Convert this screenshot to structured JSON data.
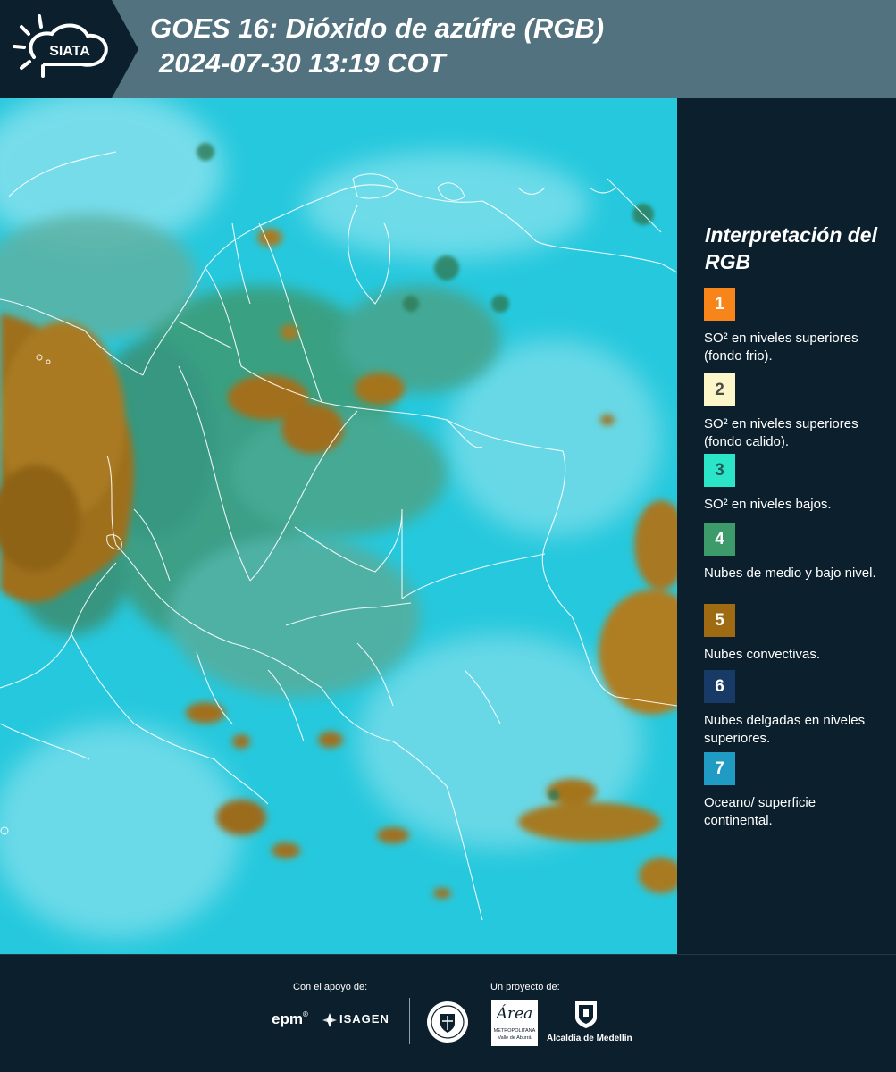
{
  "header": {
    "title_line1": "GOES 16: Dióxido de azúfre (RGB)",
    "title_line2": "2024-07-30 13:19 COT",
    "logo_text": "SIATA"
  },
  "legend": {
    "title": "Interpretación del RGB",
    "items": [
      {
        "number": "1",
        "color": "#f7851a",
        "text_color": "#ffffff",
        "label": "SO² en niveles superiores (fondo frio)."
      },
      {
        "number": "2",
        "color": "#fdf6c8",
        "text_color": "#4a4a4a",
        "label": "SO² en niveles superiores (fondo calido)."
      },
      {
        "number": "3",
        "color": "#2be5c9",
        "text_color": "#1f5a55",
        "label": "SO² en niveles bajos."
      },
      {
        "number": "4",
        "color": "#3c9a6b",
        "text_color": "#ffffff",
        "label": "Nubes de medio y bajo nivel."
      },
      {
        "number": "5",
        "color": "#9e6a12",
        "text_color": "#ffffff",
        "label": "Nubes convectivas."
      },
      {
        "number": "6",
        "color": "#173a66",
        "text_color": "#ffffff",
        "label": "Nubes delgadas en niveles superiores."
      },
      {
        "number": "7",
        "color": "#1f9bc4",
        "text_color": "#ffffff",
        "label": "Oceano/ superficie continental."
      }
    ]
  },
  "footer": {
    "support_label": "Con el apoyo de:",
    "project_label": "Un proyecto de:",
    "epm": "epm",
    "isagen": "ISAGEN",
    "area_script": "Área",
    "area_sub1": "METROPOLITANA",
    "area_sub2": "Valle de Aburrá",
    "alcaldia": "Alcaldía de Medellín"
  }
}
